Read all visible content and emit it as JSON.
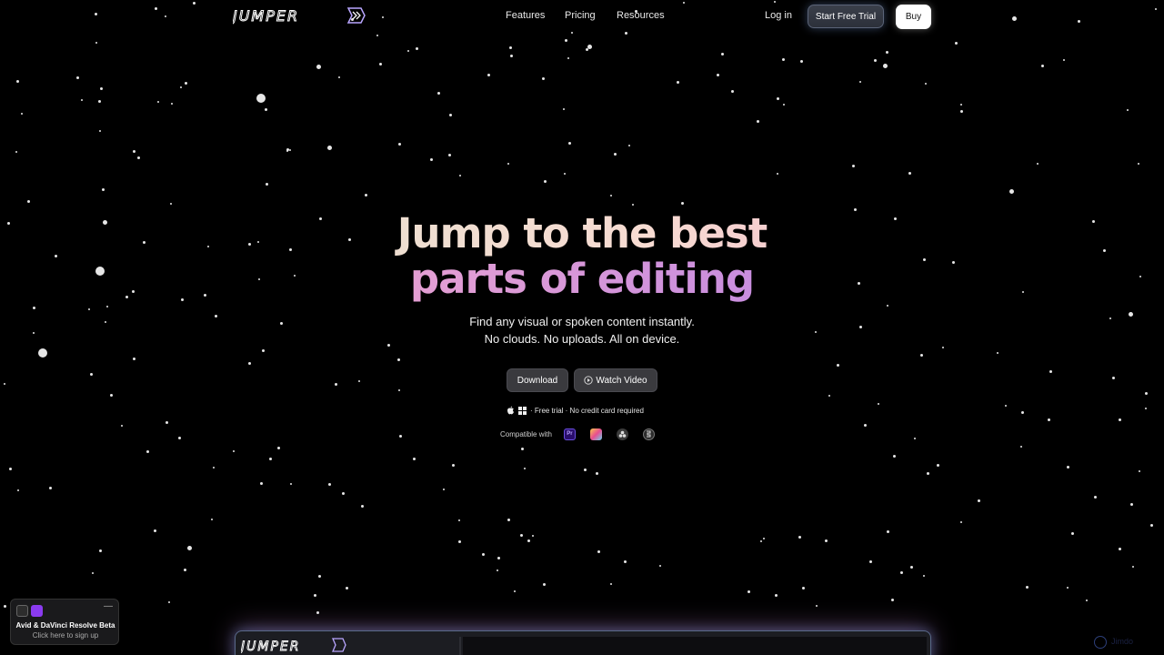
{
  "header": {
    "logo_text": "JUMPER",
    "nav": [
      "Features",
      "Pricing",
      "Resources"
    ],
    "login_label": "Log in",
    "trial_label": "Start Free Trial",
    "buy_label": "Buy"
  },
  "hero": {
    "title_line1": "Jump to the best",
    "title_line2": "parts of editing",
    "subtitle_line1": "Find any visual or spoken content instantly.",
    "subtitle_line2": "No clouds. No uploads. All on device.",
    "download_label": "Download",
    "watch_label": "Watch Video",
    "platform_icons": [
      "apple-icon",
      "windows-icon"
    ],
    "trial_note": "· Free trial · No credit card required",
    "compatible_label": "Compatible with",
    "compatible_apps": [
      {
        "name": "premiere-pro-icon",
        "text": "Pr"
      },
      {
        "name": "final-cut-pro-icon",
        "text": ""
      },
      {
        "name": "davinci-resolve-icon",
        "text": ""
      },
      {
        "name": "avid-icon",
        "text": ""
      }
    ]
  },
  "beta_widget": {
    "title": "Avid & DaVinci Resolve Beta",
    "subtitle": "Click here to sign up",
    "close_label": "—"
  },
  "preview": {
    "logo_text": "JUMPER"
  },
  "corner": {
    "text": "Jimdo"
  },
  "colors": {
    "background": "#000000",
    "gradient_teal": "#bfe9e6",
    "gradient_pink": "#f0a9c8",
    "gradient_purple": "#9b78e6",
    "button_dark": "#3a3a3e"
  }
}
